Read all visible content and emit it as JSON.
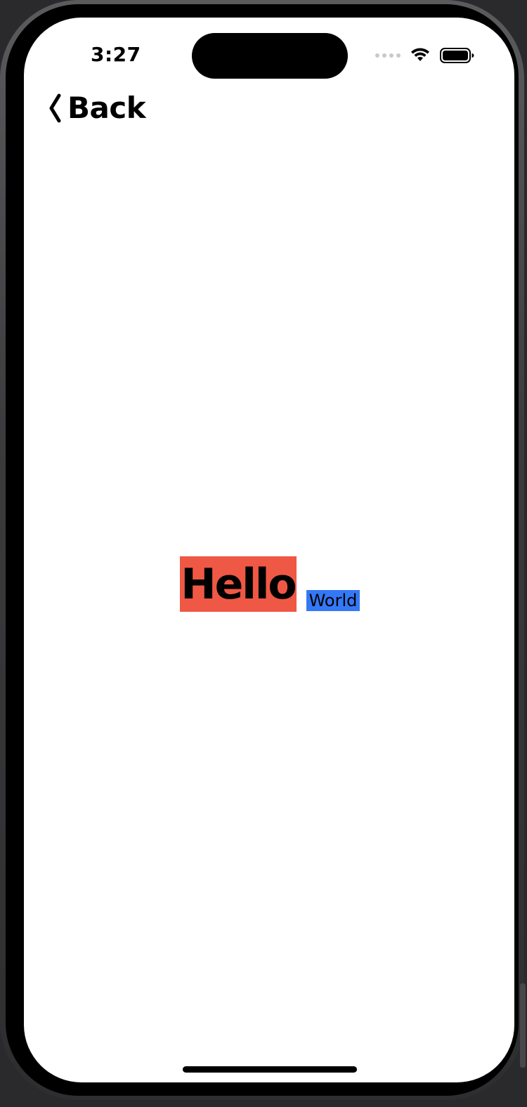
{
  "status_bar": {
    "time": "3:27",
    "signal_icon": "cellular-signal-icon",
    "wifi_icon": "wifi-icon",
    "battery_icon": "battery-icon"
  },
  "nav": {
    "back_label": "Back",
    "back_icon": "chevron-left-icon"
  },
  "content": {
    "hello": {
      "label": "Hello",
      "background": "#ef5844"
    },
    "world": {
      "label": "World",
      "background": "#3478f6"
    }
  },
  "colors": {
    "screen_background": "#ffffff",
    "text": "#000000"
  }
}
